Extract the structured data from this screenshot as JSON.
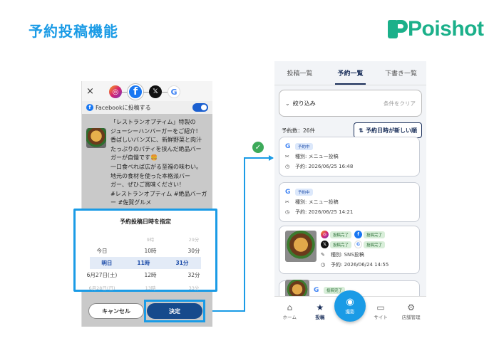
{
  "slide": {
    "title": "予約投稿機能",
    "brand": "Poishot"
  },
  "left_phone": {
    "close": "×",
    "platforms": [
      "instagram-icon",
      "facebook-icon",
      "x-icon",
      "google-icon"
    ],
    "facebook_toggle_label": "Facebookに投稿する",
    "post_text": "「レストランオプティム」特製の\nジューシーハンバーガーをご紹介！\n香ばしいバンズに、新鮮野菜と肉汁\nたっぷりのパティを挟んだ絶品バー\nガーが自慢です🍔\n一口食べれば広がる至福の味わい。\n地元の食材を使った本格派バー\nガー、ぜひご賞味ください！\n#レストランオプティム #絶品バーガ\nー #佐賀グルメ",
    "picker": {
      "title": "予約投稿日時を指定",
      "rows": [
        {
          "c1": "",
          "c2": "9時",
          "c3": "29分",
          "dim": true
        },
        {
          "c1": "今日",
          "c2": "10時",
          "c3": "30分"
        },
        {
          "c1": "明日",
          "c2": "11時",
          "c3": "31分",
          "selected": true
        },
        {
          "c1": "6月27日(土)",
          "c2": "12時",
          "c3": "32分"
        },
        {
          "c1": "6月28日(日)",
          "c2": "13時",
          "c3": "33分",
          "dim": true
        }
      ]
    },
    "cancel_label": "キャンセル",
    "decide_label": "決定"
  },
  "right_phone": {
    "tabs": [
      {
        "label": "投稿一覧",
        "active": false
      },
      {
        "label": "予約一覧",
        "active": true
      },
      {
        "label": "下書き一覧",
        "active": false
      }
    ],
    "filter_label": "絞り込み",
    "filter_clear": "条件をクリア",
    "count": "予約数：26件",
    "sort_label": "予約日時が新しい順",
    "cards": [
      {
        "badge": "予約中",
        "type": "種別: メニュー投稿",
        "time": "予約: 2026/06/25 16:48"
      },
      {
        "badge": "予約中",
        "type": "種別: メニュー投稿",
        "time": "予約: 2026/06/25 14:21"
      },
      {
        "platforms": [
          {
            "icon": "instagram-icon",
            "label": "投稿完了"
          },
          {
            "icon": "facebook-icon",
            "label": "投稿完了"
          },
          {
            "icon": "x-icon",
            "label": "投稿完了"
          },
          {
            "icon": "google-icon",
            "label": "投稿完了"
          }
        ],
        "type": "種別: SNS投稿",
        "time": "予約: 2026/06/24 14:55"
      },
      {
        "badge": "投稿完了"
      }
    ],
    "nav": [
      {
        "label": "ホーム",
        "icon": "home-icon",
        "active": false
      },
      {
        "label": "投稿",
        "icon": "post-icon",
        "active": true
      },
      {
        "label": "撮影",
        "icon": "camera-icon",
        "active": false
      },
      {
        "label": "サイト",
        "icon": "site-icon",
        "active": false
      },
      {
        "label": "店舗管理",
        "icon": "gear-icon",
        "active": false
      }
    ]
  },
  "colors": {
    "accent": "#1a9be6",
    "brand": "#1bb08a",
    "primary": "#164a8c"
  }
}
